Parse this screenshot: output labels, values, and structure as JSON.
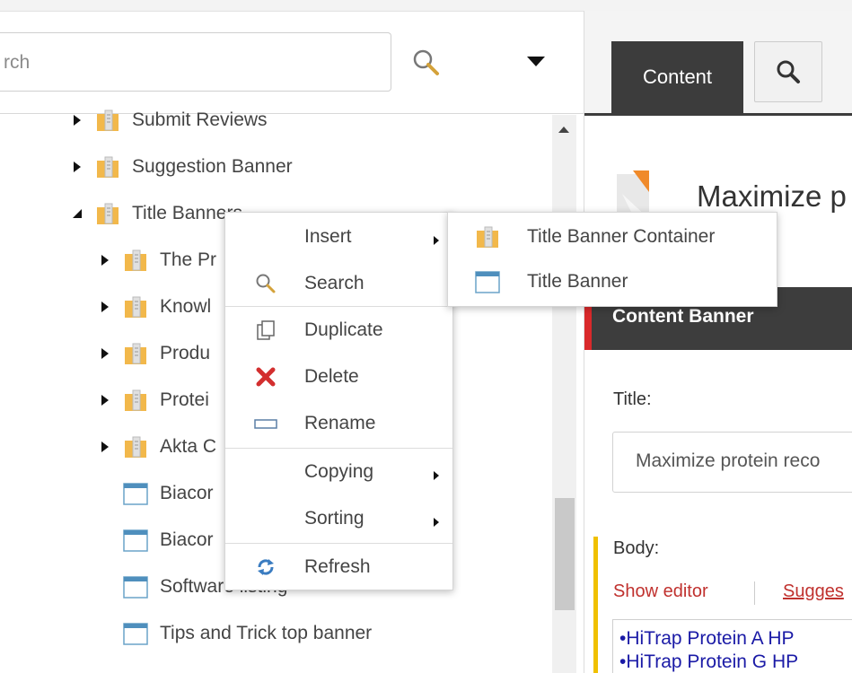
{
  "search": {
    "placeholder": "rch"
  },
  "tree": {
    "items": [
      {
        "label": "Submit Reviews",
        "expanded": false
      },
      {
        "label": "Suggestion Banner",
        "expanded": false
      },
      {
        "label": "Title Banners",
        "expanded": true
      },
      {
        "label": "The Pr",
        "expanded": false
      },
      {
        "label": "Knowl",
        "expanded": false
      },
      {
        "label": "Produ",
        "expanded": false
      },
      {
        "label": "Protei",
        "expanded": false
      },
      {
        "label": "Akta C",
        "expanded": false
      },
      {
        "label": "Biacor"
      },
      {
        "label": "Biacor"
      },
      {
        "label": "Software listing"
      },
      {
        "label": "Tips and Trick top banner"
      }
    ]
  },
  "context_menu": {
    "insert": "Insert",
    "search": "Search",
    "duplicate": "Duplicate",
    "delete": "Delete",
    "rename": "Rename",
    "copying": "Copying",
    "sorting": "Sorting",
    "refresh": "Refresh"
  },
  "insert_submenu": {
    "items": [
      "Title Banner Container",
      "Title Banner"
    ]
  },
  "right": {
    "tab_content": "Content",
    "item_title": "Maximize p",
    "section": "Content Banner",
    "title_label": "Title:",
    "title_value": "Maximize protein reco",
    "body_label": "Body:",
    "show_editor": "Show editor",
    "suggest": "Sugges",
    "body_lines": [
      "•HiTrap Protein A HP",
      "•HiTrap Protein G HP"
    ]
  },
  "colors": {
    "accent_red": "#d9292b",
    "dark_tab": "#3c3c3c",
    "body_bar": "#f0c000",
    "link_red": "#c0312e"
  }
}
